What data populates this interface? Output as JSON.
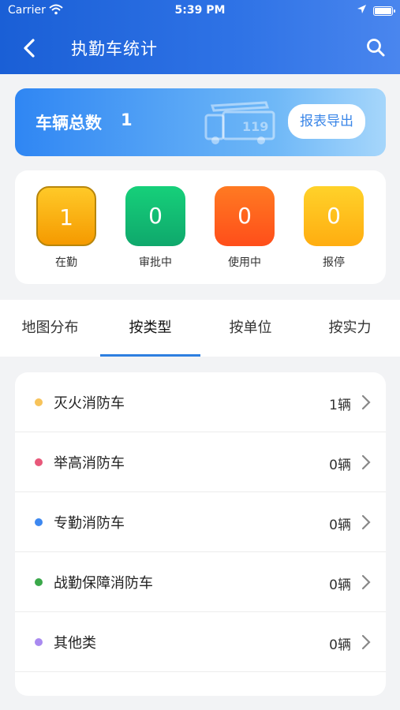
{
  "status_bar": {
    "carrier": "Carrier",
    "time": "5:39 PM"
  },
  "header": {
    "title": "执勤车统计",
    "back_icon": "chevron-left-icon",
    "search_icon": "search-icon"
  },
  "summary": {
    "label": "车辆总数",
    "count": "1",
    "export_label": "报表导出",
    "illustration": "fire-truck-119-icon"
  },
  "stats": [
    {
      "value": "1",
      "label": "在勤",
      "color": "#f5b400"
    },
    {
      "value": "0",
      "label": "审批中",
      "color": "#19b874"
    },
    {
      "value": "0",
      "label": "使用中",
      "color": "#ff5a1f"
    },
    {
      "value": "0",
      "label": "报停",
      "color": "#ffc21a"
    }
  ],
  "tabs": [
    {
      "label": "地图分布",
      "active": false
    },
    {
      "label": "按类型",
      "active": true
    },
    {
      "label": "按单位",
      "active": false
    },
    {
      "label": "按实力",
      "active": false
    }
  ],
  "list": [
    {
      "label": "灭火消防车",
      "count": "1辆",
      "color": "#f7c35a"
    },
    {
      "label": "举高消防车",
      "count": "0辆",
      "color": "#e8587a"
    },
    {
      "label": "专勤消防车",
      "count": "0辆",
      "color": "#3d88f0"
    },
    {
      "label": "战勤保障消防车",
      "count": "0辆",
      "color": "#3aa84a"
    },
    {
      "label": "其他类",
      "count": "0辆",
      "color": "#a98af0"
    }
  ]
}
